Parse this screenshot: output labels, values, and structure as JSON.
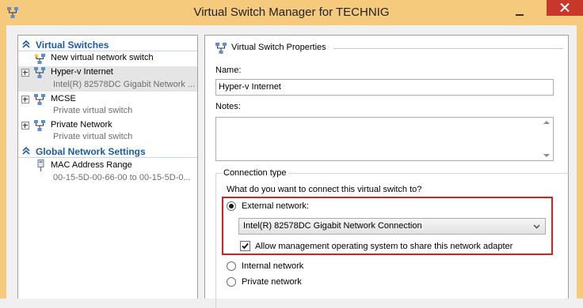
{
  "window": {
    "title": "Virtual Switch Manager for TECHNIG"
  },
  "sidebar": {
    "virtual_switches_header": "Virtual Switches",
    "new_switch_label": "New virtual network switch",
    "switches": [
      {
        "name": "Hyper-v Internet",
        "detail": "Intel(R) 82578DC Gigabit Network ..."
      },
      {
        "name": "MCSE",
        "detail": "Private virtual switch"
      },
      {
        "name": "Private Network",
        "detail": "Private virtual switch"
      }
    ],
    "global_header": "Global Network Settings",
    "mac_label": "MAC Address Range",
    "mac_value": "00-15-5D-00-66-00 to 00-15-5D-0..."
  },
  "properties": {
    "header": "Virtual Switch Properties",
    "name_label": "Name:",
    "name_value": "Hyper-v Internet",
    "notes_label": "Notes:",
    "notes_value": "",
    "connection_type_label": "Connection type",
    "connection_question": "What do you want to connect this virtual switch to?",
    "external_label": "External network:",
    "adapter_selected": "Intel(R) 82578DC Gigabit Network Connection",
    "allow_mgmt_label": "Allow management operating system to share this network adapter",
    "allow_mgmt_checked": true,
    "internal_label": "Internal network",
    "private_label": "Private network",
    "selected_connection": "external"
  },
  "colors": {
    "title_bar": "#f5ca7d",
    "close_button": "#c7382b",
    "section_header": "#1e5aa8",
    "highlight": "#d81f26"
  }
}
